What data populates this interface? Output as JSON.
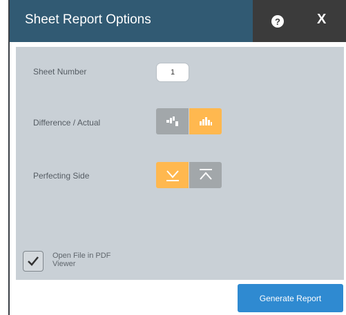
{
  "dialog": {
    "title": "Sheet Report Options",
    "help_label": "?",
    "close_label": "X"
  },
  "form": {
    "sheet_number_label": "Sheet Number",
    "sheet_number_value": "1",
    "difference_actual_label": "Difference / Actual",
    "difference_actual_options": [
      {
        "icon": "difference-chart-icon",
        "selected": false
      },
      {
        "icon": "actual-bar-chart-icon",
        "selected": true
      }
    ],
    "perfecting_side_label": "Perfecting Side",
    "perfecting_side_options": [
      {
        "icon": "bottom-side-icon",
        "selected": true
      },
      {
        "icon": "top-side-icon",
        "selected": false
      }
    ],
    "open_pdf_label": "Open File in PDF Viewer",
    "open_pdf_checked": true
  },
  "actions": {
    "generate_label": "Generate Report"
  },
  "colors": {
    "title_bar": "#315a73",
    "action_area": "#3b3b3b",
    "panel": "#c9d0d6",
    "selected": "#ffb84f",
    "unselected": "#a2a7aa",
    "primary_button": "#2f8ad1"
  }
}
